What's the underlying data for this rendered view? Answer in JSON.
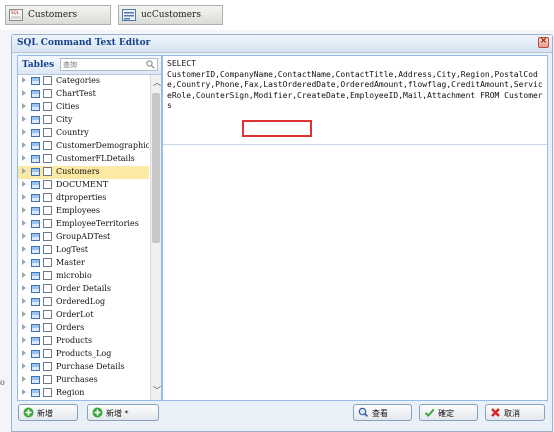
{
  "doc_tabs": [
    {
      "label": "Customers"
    },
    {
      "label": "ucCustomers"
    }
  ],
  "background": {
    "edge_text": "o"
  },
  "dialog": {
    "title": "SQL Command Text Editor",
    "close_label": "×"
  },
  "tables_panel": {
    "title": "Tables",
    "search_placeholder": "查詢",
    "items": [
      {
        "label": "Categories"
      },
      {
        "label": "ChartTest"
      },
      {
        "label": "Cities"
      },
      {
        "label": "City"
      },
      {
        "label": "Country"
      },
      {
        "label": "CustomerDemographics"
      },
      {
        "label": "CustomerFLDetails"
      },
      {
        "label": "Customers",
        "selected": true
      },
      {
        "label": "DOCUMENT"
      },
      {
        "label": "dtproperties"
      },
      {
        "label": "Employees"
      },
      {
        "label": "EmployeeTerritories"
      },
      {
        "label": "GroupADTest"
      },
      {
        "label": "LogTest"
      },
      {
        "label": "Master"
      },
      {
        "label": "microbio"
      },
      {
        "label": "Order Details"
      },
      {
        "label": "OrderedLog"
      },
      {
        "label": "OrderLot"
      },
      {
        "label": "Orders"
      },
      {
        "label": "Products"
      },
      {
        "label": "Products_Log"
      },
      {
        "label": "Purchase Details"
      },
      {
        "label": "Purchases"
      },
      {
        "label": "Region"
      }
    ]
  },
  "editor": {
    "sql": "SELECT\nCustomerID,CompanyName,ContactName,ContactTitle,Address,City,Region,PostalCode,Country,Phone,Fax,LastOrderedDate,OrderedAmount,flowflag,CreditAmount,ServiceRole,CounterSign,Modifier,CreateDate,EmployeeID,Mail,Attachment FROM Customers",
    "highlighted_token": "Attachment"
  },
  "toolbar": {
    "add_label": "新增",
    "add_star_label": "新增 *",
    "view_label": "查看",
    "ok_label": "確定",
    "cancel_label": "取消"
  },
  "colors": {
    "title_text": "#15428b",
    "selected_row": "#fbe9a4",
    "highlight_border": "#dd3333",
    "add_icon": "#3aa53a",
    "ok_icon": "#3aa53a",
    "cancel_icon": "#d22"
  }
}
